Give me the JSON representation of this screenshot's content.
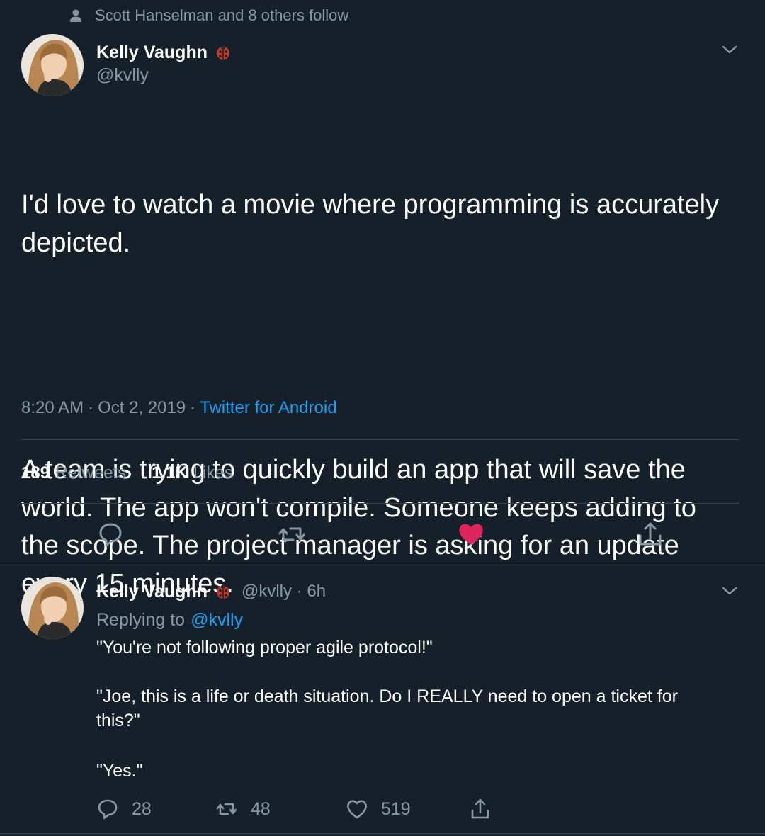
{
  "social_context": {
    "text": "Scott Hanselman and 8 others follow",
    "icon": "person-icon"
  },
  "main_tweet": {
    "author_name": "Kelly Vaughn",
    "handle": "@kvlly",
    "badge_icon": "ladybug-emoji-icon",
    "text_paragraph_1": "I'd love to watch a movie where programming is accurately depicted.",
    "text_paragraph_2": "A team is trying to quickly build an app that will save the world. The app won't compile. Someone keeps adding to the scope. The project manager is asking for an update every 15 minutes.",
    "time": "8:20 AM",
    "date": "Oct 2, 2019",
    "separator": "·",
    "source": "Twitter for Android",
    "retweets_count": "189",
    "retweets_label": "Retweets",
    "likes_count": "1.1K",
    "likes_label": "Likes",
    "liked": true,
    "like_color": "#e0245e"
  },
  "reply_tweet": {
    "author_name": "Kelly Vaughn",
    "handle_time": "@kvlly · 6h",
    "replying_to_label": "Replying to",
    "replying_to_handle": "@kvlly",
    "line_1": "\"You're not following proper agile protocol!\"",
    "line_2": "\"Joe, this is a life or death situation. Do I REALLY need to open a ticket for this?\"",
    "line_3": "\"Yes.\"",
    "reply_count": "28",
    "retweet_count": "48",
    "like_count": "519"
  },
  "colors": {
    "background": "#15202b",
    "text_primary": "#ffffff",
    "text_secondary": "#8899a6",
    "link": "#1da1f2",
    "divider": "#38444d"
  }
}
